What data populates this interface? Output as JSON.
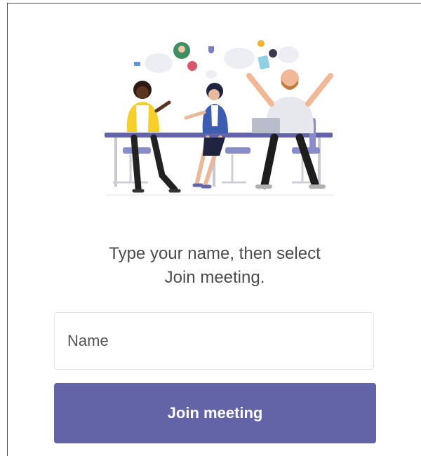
{
  "illustration": {
    "name": "team-meeting-illustration",
    "accent_color": "#6264a7"
  },
  "instruction": {
    "line1": "Type your name, then select",
    "line2": "Join meeting."
  },
  "name_input": {
    "placeholder": "Name",
    "value": ""
  },
  "join_button": {
    "label": "Join meeting",
    "color": "#6264a7"
  }
}
